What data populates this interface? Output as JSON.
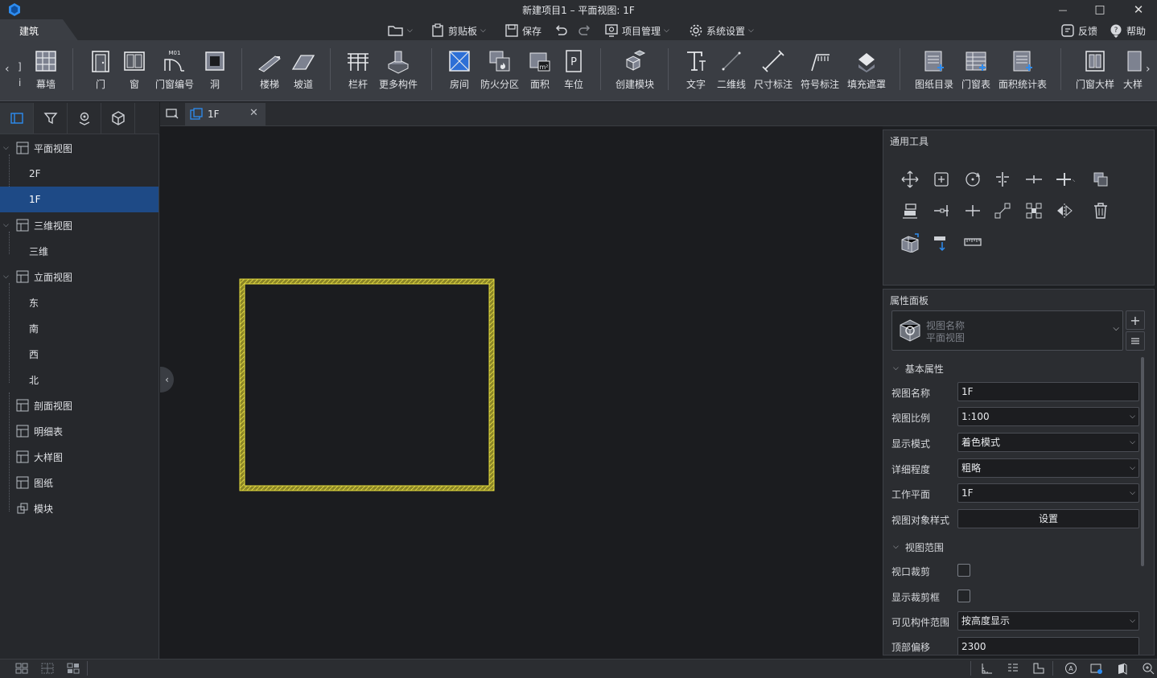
{
  "window": {
    "title": "新建项目1 – 平面视图: 1F",
    "minimize": "—",
    "maximize": "□",
    "close": "✕"
  },
  "menubar": {
    "ribbon_tab": "建筑",
    "quick": [
      {
        "label": "",
        "icon": "folder-icon"
      },
      {
        "label": "剪贴板",
        "icon": "clipboard-icon"
      },
      {
        "label": "保存",
        "icon": "save-icon"
      },
      {
        "label": "项目管理",
        "icon": "project-icon"
      },
      {
        "label": "系统设置",
        "icon": "gear-icon"
      }
    ],
    "feedback": "反馈",
    "help": "帮助"
  },
  "ribbon": {
    "scroll_left": "‹",
    "scroll_right": "›",
    "left_cut_label": "i",
    "buttons": [
      "幕墙",
      "门",
      "窗",
      "门窗编号",
      "洞",
      "楼梯",
      "坡道",
      "栏杆",
      "更多构件",
      "房间",
      "防火分区",
      "面积",
      "车位",
      "创建模块",
      "文字",
      "二维线",
      "尺寸标注",
      "符号标注",
      "填充遮罩",
      "图纸目录",
      "门窗表",
      "面积统计表",
      "门窗大样",
      "大样"
    ],
    "door_tag_text": "M01"
  },
  "left_panel": {
    "tree": [
      {
        "label": "平面视图",
        "level": 0,
        "expanded": true
      },
      {
        "label": "2F",
        "level": 1
      },
      {
        "label": "1F",
        "level": 1,
        "selected": true
      },
      {
        "label": "三维视图",
        "level": 0,
        "expanded": true
      },
      {
        "label": "三维",
        "level": 1
      },
      {
        "label": "立面视图",
        "level": 0,
        "expanded": true
      },
      {
        "label": "东",
        "level": 1
      },
      {
        "label": "南",
        "level": 1
      },
      {
        "label": "西",
        "level": 1
      },
      {
        "label": "北",
        "level": 1
      },
      {
        "label": "剖面视图",
        "level": 0
      },
      {
        "label": "明细表",
        "level": 0
      },
      {
        "label": "大样图",
        "level": 0
      },
      {
        "label": "图纸",
        "level": 0
      },
      {
        "label": "模块",
        "level": 0
      }
    ]
  },
  "tabs": {
    "active": "1F"
  },
  "tools_panel": {
    "title": "通用工具"
  },
  "props_panel": {
    "title": "属性面板",
    "type_selector": {
      "line1": "视图名称",
      "line2": "平面视图"
    },
    "section_basic": "基本属性",
    "view_name_label": "视图名称",
    "view_name_value": "1F",
    "scale_label": "视图比例",
    "scale_value": "1:100",
    "display_label": "显示模式",
    "display_value": "着色模式",
    "detail_label": "详细程度",
    "detail_value": "粗略",
    "workplane_label": "工作平面",
    "workplane_value": "1F",
    "objstyle_label": "视图对象样式",
    "objstyle_button": "设置",
    "section_range": "视图范围",
    "crop_label": "视口裁剪",
    "showcrop_label": "显示裁剪框",
    "visible_label": "可见构件范围",
    "visible_value": "按高度显示",
    "top_offset_label": "顶部偏移",
    "top_offset_value": "2300"
  },
  "colors": {
    "accent": "#1e4a86",
    "brand": "#2d8cf0",
    "wall_yellow": "#d9cf3a"
  }
}
